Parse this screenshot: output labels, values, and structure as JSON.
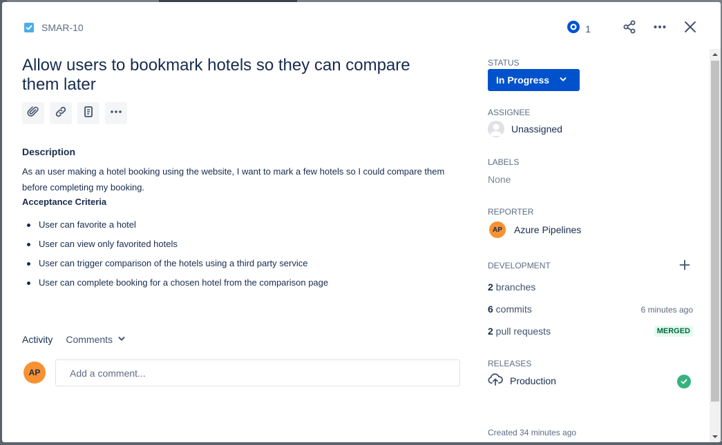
{
  "issue": {
    "key": "SMAR-10",
    "title": "Allow users to bookmark hotels so they can compare them later"
  },
  "header": {
    "watch_count": "1"
  },
  "description": {
    "heading": "Description",
    "text": "As an user making a hotel booking using the website, I want to mark a few hotels so I could compare them before completing my booking.",
    "acceptance_heading": "Acceptance Criteria",
    "criteria": [
      "User can favorite a hotel",
      "User can view only favorited hotels",
      "User can trigger comparison of the hotels using a third party service",
      "User can complete booking for a chosen hotel from the comparison page"
    ]
  },
  "activity": {
    "label": "Activity",
    "filter": "Comments",
    "avatar_initials": "AP",
    "comment_placeholder": "Add a comment..."
  },
  "sidebar": {
    "status_label": "STATUS",
    "status_value": "In Progress",
    "assignee_label": "ASSIGNEE",
    "assignee_value": "Unassigned",
    "labels_label": "LABELS",
    "labels_value": "None",
    "reporter_label": "REPORTER",
    "reporter_initials": "AP",
    "reporter_value": "Azure Pipelines",
    "development_label": "DEVELOPMENT",
    "branches_count": "2",
    "branches_text": " branches",
    "commits_count": "6",
    "commits_text": " commits",
    "commits_time": "6 minutes ago",
    "prs_count": "2",
    "prs_text": " pull requests",
    "prs_status": "MERGED",
    "releases_label": "RELEASES",
    "release_value": "Production",
    "created": "Created 34 minutes ago"
  },
  "colors": {
    "primary": "#0052cc",
    "story": "#4bade8",
    "avatar": "#f79232",
    "success": "#36b37e"
  }
}
